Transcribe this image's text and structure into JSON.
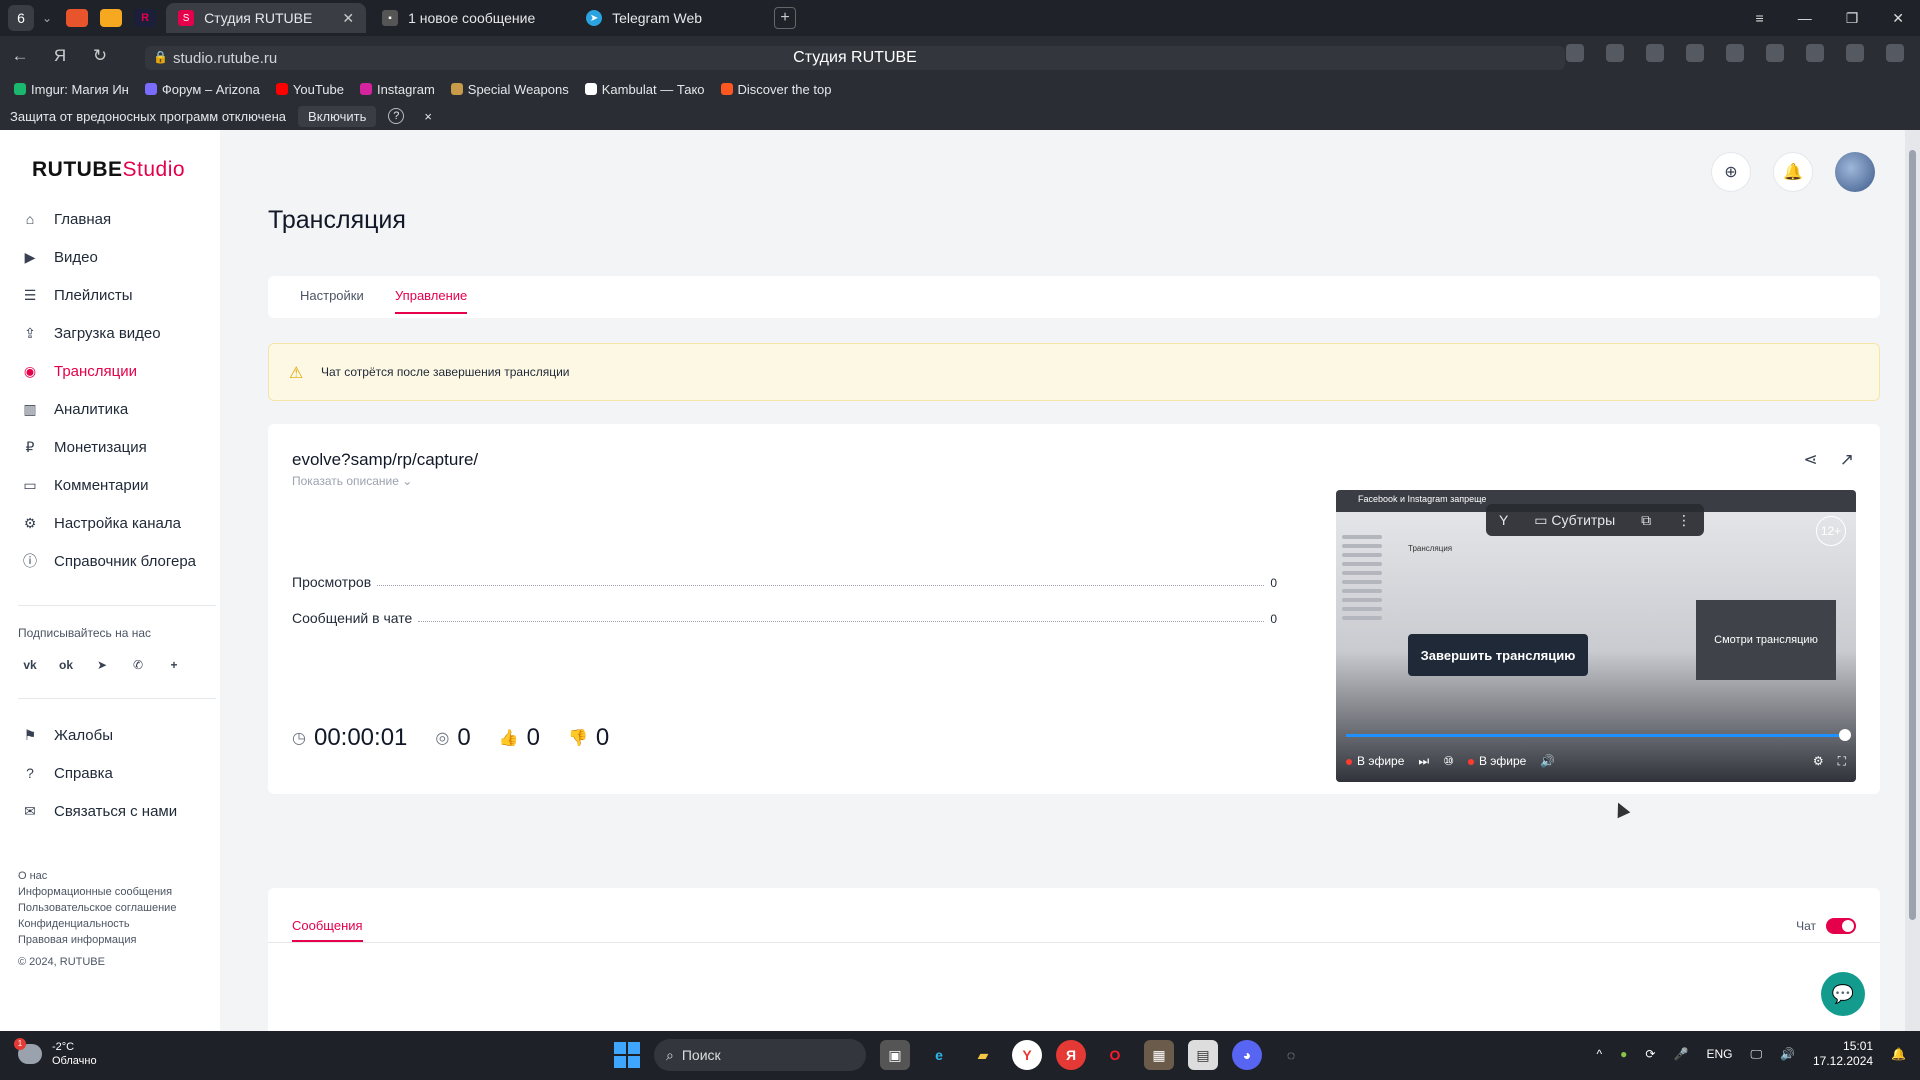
{
  "browser": {
    "tab_count": "6",
    "tabs": [
      {
        "title": "Студия RUTUBE",
        "active": true
      },
      {
        "title": "1 новое сообщение",
        "active": false
      },
      {
        "title": "Telegram Web",
        "active": false
      }
    ],
    "url": "studio.rutube.ru",
    "page_title": "Студия RUTUBE",
    "bookmarks": [
      "Imgur: Магия Ин",
      "Форум – Arizona",
      "YouTube",
      "Instagram",
      "Special Weapons",
      "Kambulat — Тако",
      "Discover the top"
    ],
    "infobar": {
      "text": "Защита от вредоносных программ отключена",
      "enable_label": "Включить",
      "help": "?",
      "close": "×"
    }
  },
  "app": {
    "logo_main": "RUTUBE",
    "logo_sub": "Studio",
    "nav": [
      {
        "label": "Главная",
        "icon": "home-icon",
        "glyph": "⌂"
      },
      {
        "label": "Видео",
        "icon": "video-icon",
        "glyph": "▶"
      },
      {
        "label": "Плейлисты",
        "icon": "playlist-icon",
        "glyph": "☰"
      },
      {
        "label": "Загрузка видео",
        "icon": "upload-icon",
        "glyph": "⇪"
      },
      {
        "label": "Трансляции",
        "icon": "broadcast-icon",
        "glyph": "◉",
        "active": true
      },
      {
        "label": "Аналитика",
        "icon": "analytics-icon",
        "glyph": "▥"
      },
      {
        "label": "Монетизация",
        "icon": "monetization-icon",
        "glyph": "₽"
      },
      {
        "label": "Комментарии",
        "icon": "comments-icon",
        "glyph": "▭"
      },
      {
        "label": "Настройка канала",
        "icon": "gear-icon",
        "glyph": "⚙"
      },
      {
        "label": "Справочник блогера",
        "icon": "info-icon",
        "glyph": "ⓘ"
      }
    ],
    "follow_label": "Подписывайтесь на нас",
    "socials": [
      "vk",
      "ok",
      "tg",
      "vb",
      "+"
    ],
    "nav2": [
      {
        "label": "Жалобы",
        "icon": "flag-icon",
        "glyph": "⚑"
      },
      {
        "label": "Справка",
        "icon": "help-icon",
        "glyph": "?"
      },
      {
        "label": "Связаться с нами",
        "icon": "mail-icon",
        "glyph": "✉"
      }
    ],
    "footer_links": [
      "О нас",
      "Информационные сообщения",
      "Пользовательское соглашение",
      "Конфиденциальность",
      "Правовая информация"
    ],
    "copyright": "© 2024, RUTUBE"
  },
  "main": {
    "title": "Трансляция",
    "tabs": [
      "Настройки",
      "Управление"
    ],
    "warning": "Чат сотрётся после завершения трансляции",
    "stream": {
      "title": "evolve?samp/rp/capture/",
      "show_description": "Показать описание ⌄",
      "stats": [
        {
          "label": "Просмотров",
          "value": "0"
        },
        {
          "label": "Сообщений в чате",
          "value": "0"
        }
      ],
      "timer": "00:00:01",
      "viewers": "0",
      "likes": "0",
      "dislikes": "0",
      "end_button": "Завершить трансляцию"
    },
    "player": {
      "inner_tab": "Facebook и Instagram запреще",
      "subtitles_label": "Субтитры",
      "age": "12+",
      "watch_text": "Смотри трансляцию",
      "live_label": "В эфире",
      "live_label2": "В эфире",
      "mini_title": "Трансляция",
      "progress": 1.0
    },
    "messages": {
      "tab": "Сообщения",
      "chat_label": "Чат",
      "chat_enabled": true
    }
  },
  "taskbar": {
    "temp": "-2°C",
    "weather": "Облачно",
    "weather_badge": "1",
    "search": "Поиск",
    "lang": "ENG",
    "time": "15:01",
    "date": "17.12.2024"
  }
}
